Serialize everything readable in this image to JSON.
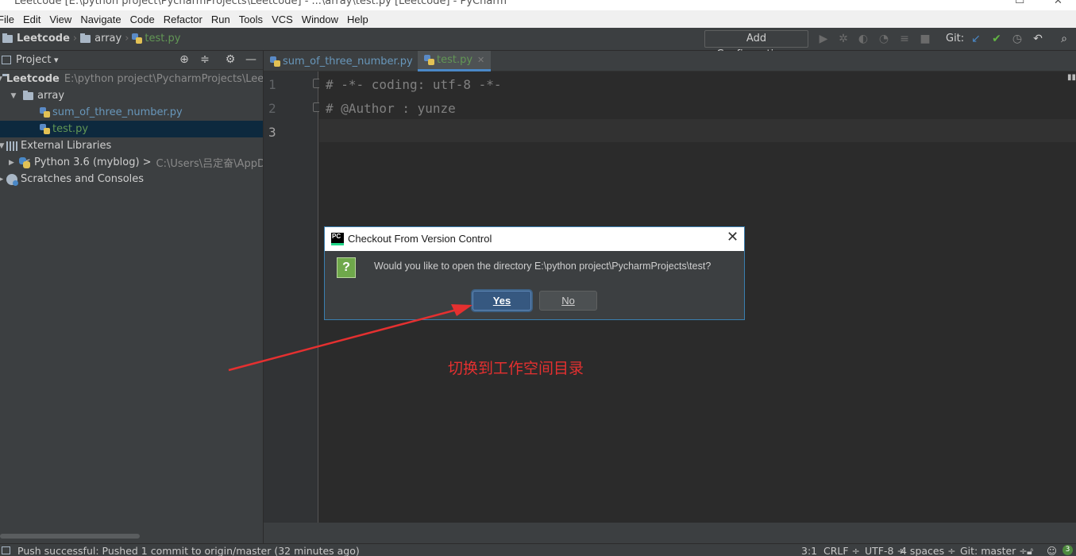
{
  "window": {
    "title": "Leetcode [E:\\python project\\PycharmProjects\\Leetcode] - ...\\array\\test.py [Leetcode] - PyCharm"
  },
  "menu": [
    "File",
    "Edit",
    "View",
    "Navigate",
    "Code",
    "Refactor",
    "Run",
    "Tools",
    "VCS",
    "Window",
    "Help"
  ],
  "nav": {
    "breadcrumb": [
      "Leetcode",
      "array",
      "test.py"
    ],
    "add_configuration": "Add Configuration...",
    "git_label": "Git:"
  },
  "project": {
    "title": "Project",
    "tree": [
      {
        "label": "Leetcode",
        "hint": "E:\\python project\\PycharmProjects\\Leetcode"
      },
      {
        "label": "array"
      },
      {
        "label": "sum_of_three_number.py"
      },
      {
        "label": "test.py"
      },
      {
        "label": "External Libraries"
      },
      {
        "label": "< Python 3.6 (myblog) >",
        "hint": "C:\\Users\\吕定奋\\AppDa"
      },
      {
        "label": "Scratches and Consoles"
      }
    ]
  },
  "tabs": [
    {
      "label": "sum_of_three_number.py"
    },
    {
      "label": "test.py"
    }
  ],
  "editor": {
    "line_numbers": [
      "1",
      "2",
      "3"
    ],
    "lines": [
      "# -*- coding: utf-8 -*-",
      "# @Author : yunze",
      ""
    ]
  },
  "dialog": {
    "title": "Checkout From Version Control",
    "message": "Would you like to open the directory E:\\python project\\PycharmProjects\\test?",
    "yes_label": "Yes",
    "no_label": "No"
  },
  "annotation": {
    "text": "切换到工作空间目录",
    "color": "#e53030"
  },
  "status": {
    "message": "Push successful: Pushed 1 commit to origin/master (32 minutes ago)",
    "position": "3:1",
    "line_sep": "CRLF ÷",
    "encoding": "UTF-8 ÷",
    "indent": "4 spaces ÷",
    "git_branch": "Git: master ÷",
    "notifications": "3"
  },
  "colors": {
    "accent": "#4a88c7",
    "selection": "#0d293e",
    "project_file": "#6897bb",
    "current_file": "#629755"
  }
}
